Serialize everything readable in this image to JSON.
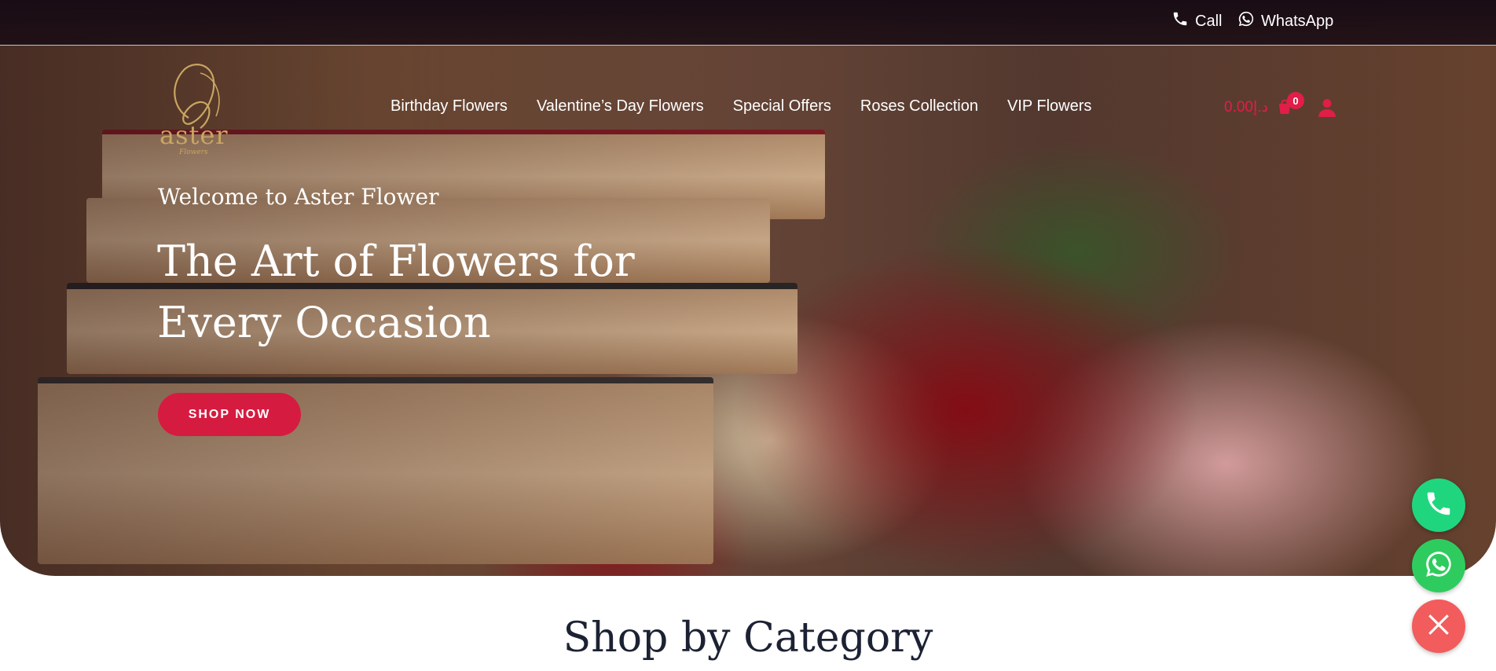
{
  "topbar": {
    "call_label": "Call",
    "whatsapp_label": "WhatsApp",
    "call_icon": "phone-icon",
    "whatsapp_icon": "whatsapp-icon"
  },
  "brand": {
    "logo_text": "aster",
    "logo_sub": "Flowers"
  },
  "nav": {
    "items": [
      {
        "label": "Birthday Flowers"
      },
      {
        "label": "Valentine’s Day Flowers"
      },
      {
        "label": "Special Offers"
      },
      {
        "label": "Roses Collection"
      },
      {
        "label": "VIP Flowers"
      }
    ]
  },
  "cart": {
    "total": "0.00",
    "currency_symbol": "د.إ",
    "count": "0",
    "icon": "cart-icon"
  },
  "account": {
    "icon": "user-icon"
  },
  "hero": {
    "welcome": "Welcome to Aster Flower",
    "headline": "The Art of Flowers for Every Occasion",
    "cta_label": "SHOP NOW"
  },
  "section": {
    "title": "Shop by Category"
  },
  "floating": {
    "call_icon": "phone-icon",
    "whatsapp_icon": "whatsapp-icon",
    "close_icon": "close-icon"
  },
  "colors": {
    "accent": "#d61b40",
    "topbar": "#190c14",
    "call_green": "#1fd67f",
    "whatsapp_green": "#2ecc5e",
    "close_red": "#f25c5c",
    "logo_gold": "#c9a562"
  }
}
